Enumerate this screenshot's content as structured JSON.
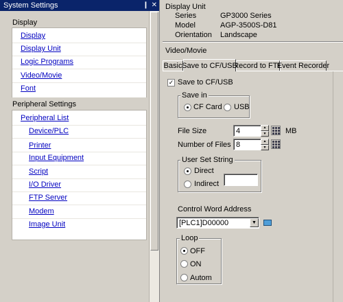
{
  "left_panel": {
    "title": "System Settings",
    "pin_glyph": "❙",
    "close_glyph": "✕",
    "groups": [
      {
        "header": "Display",
        "items": [
          "Display",
          "Display Unit",
          "Logic Programs",
          "Video/Movie",
          "Font"
        ]
      },
      {
        "header": "Peripheral Settings",
        "items": [
          "Peripheral List"
        ],
        "subitems": [
          "Device/PLC",
          "Printer",
          "Input Equipment",
          "Script",
          "I/O Driver",
          "FTP Server",
          "Modem",
          "Image Unit"
        ]
      }
    ]
  },
  "display_unit": {
    "title": "Display Unit",
    "rows": [
      {
        "label": "Series",
        "value": "GP3000 Series"
      },
      {
        "label": "Model",
        "value": "AGP-3500S-D81"
      },
      {
        "label": "Orientation",
        "value": "Landscape"
      }
    ]
  },
  "video_movie": {
    "title": "Video/Movie",
    "tabs": [
      "Basic",
      "Save to CF/USB",
      "Record to FTP",
      "Event Recorder"
    ],
    "active_tab": 1,
    "save_checkbox": {
      "label": "Save to CF/USB",
      "checked": true
    },
    "save_in": {
      "title": "Save in",
      "options": [
        "CF Card",
        "USB"
      ],
      "selected": 0
    },
    "file_size": {
      "label": "File Size",
      "value": "4",
      "unit": "MB"
    },
    "number_of_files": {
      "label": "Number of Files",
      "value": "8"
    },
    "user_set_string": {
      "title": "User Set String",
      "options": [
        "Direct",
        "Indirect"
      ],
      "selected": 0
    },
    "control_word": {
      "label": "Control Word Address",
      "value": "[PLC1]D00000"
    },
    "loop": {
      "title": "Loop",
      "options": [
        "OFF",
        "ON",
        "Autom"
      ],
      "selected": 0
    }
  },
  "colors": {
    "titlebar": "#0a246a",
    "link": "#0000c0",
    "background": "#d4d0c8"
  }
}
